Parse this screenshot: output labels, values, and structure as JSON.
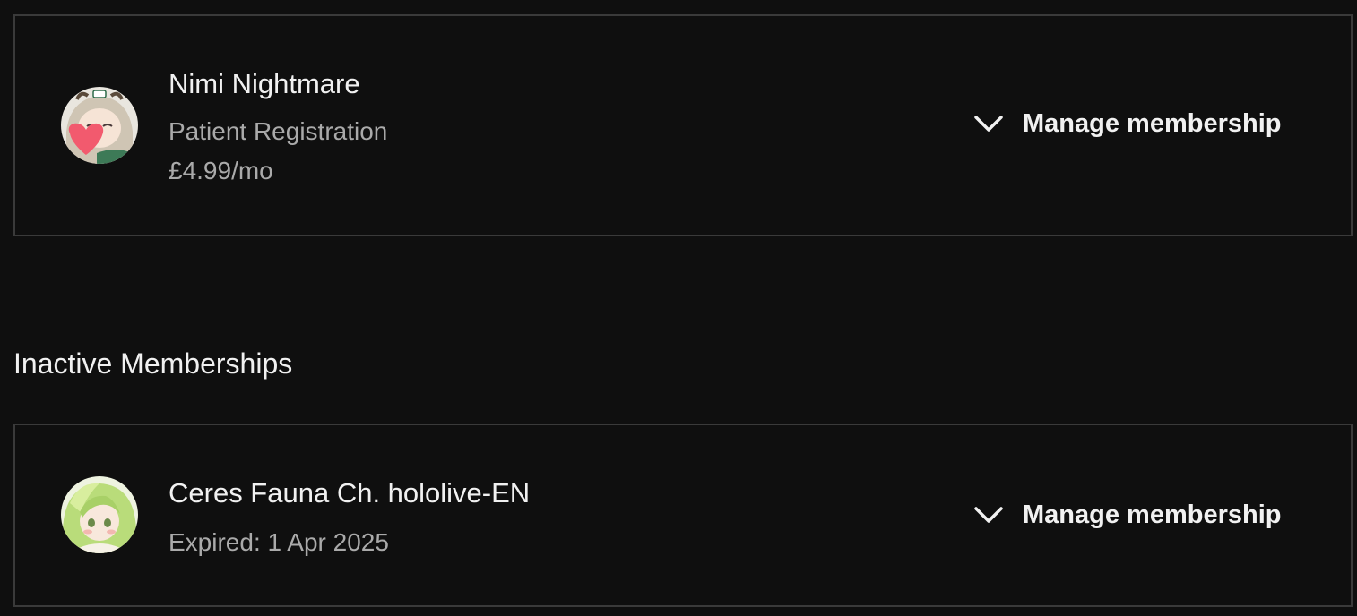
{
  "active_memberships": [
    {
      "channel_name": "Nimi Nightmare",
      "tier": "Patient Registration",
      "price": "£4.99/mo",
      "manage_label": "Manage membership",
      "avatar_icon": "avatar-nimi-icon"
    }
  ],
  "inactive_section": {
    "title": "Inactive Memberships"
  },
  "inactive_memberships": [
    {
      "channel_name": "Ceres Fauna Ch. hololive-EN",
      "status": "Expired: 1 Apr 2025",
      "manage_label": "Manage membership",
      "avatar_icon": "avatar-fauna-icon"
    }
  ],
  "icons": {
    "manage_toggle": "chevron-down-icon"
  },
  "colors": {
    "background": "#0f0f0f",
    "border": "#3a3a3a",
    "primary_text": "#f1f1f1",
    "secondary_text": "#aaaaaa"
  }
}
